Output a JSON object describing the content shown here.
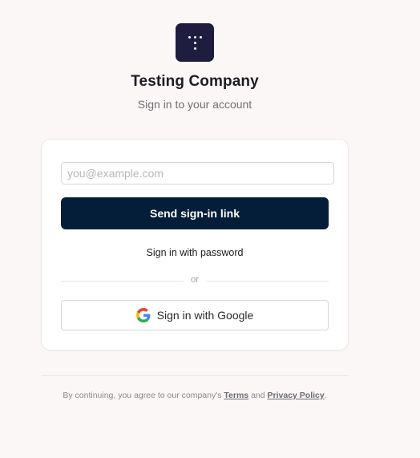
{
  "brand": {
    "logo_icon": "dotted-t-logo-icon",
    "logo_bg_color": "#1e1d3f",
    "company_name": "Testing Company",
    "subtitle": "Sign in to your account"
  },
  "form": {
    "email_placeholder": "you@example.com",
    "email_value": "",
    "send_button_label": "Send sign-in link",
    "send_button_color": "#041e3a",
    "password_link_label": "Sign in with password",
    "divider_label": "or",
    "google_button_label": "Sign in with Google",
    "google_icon": "google-g-icon"
  },
  "footer": {
    "prefix": "By continuing, you agree to our company's",
    "terms_label": "Terms",
    "conjunction": "and",
    "privacy_label": "Privacy Policy",
    "suffix": "."
  }
}
